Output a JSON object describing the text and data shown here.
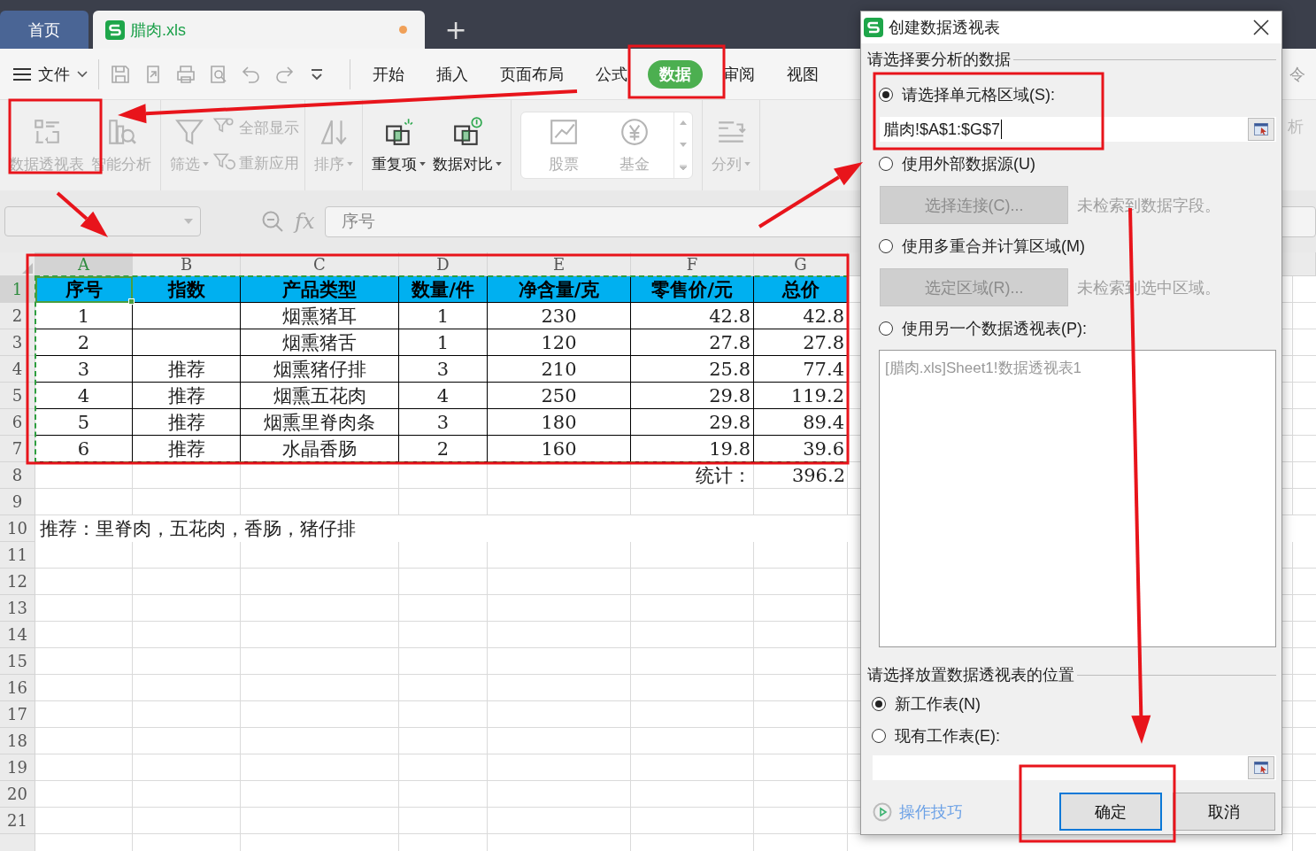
{
  "tabs": [
    {
      "label": "首页",
      "selected": false
    },
    {
      "label": "腊肉.xls",
      "selected": true,
      "modified": true
    }
  ],
  "new_tab": "+",
  "menu": {
    "file": "文件",
    "tabs": [
      {
        "label": "开始",
        "selected": false
      },
      {
        "label": "插入",
        "selected": false
      },
      {
        "label": "页面布局",
        "selected": false
      },
      {
        "label": "公式",
        "selected": false
      },
      {
        "label": "数据",
        "selected": true
      },
      {
        "label": "审阅",
        "selected": false
      },
      {
        "label": "视图",
        "selected": false
      }
    ],
    "overflow_text": "令"
  },
  "ribbon": {
    "groups": [
      {
        "items": [
          {
            "kind": "large",
            "label": "数据透视表",
            "disabled": true,
            "dropdown": false
          },
          {
            "kind": "large",
            "label": "智能分析",
            "disabled": true,
            "dropdown": false
          }
        ]
      },
      {
        "items": [
          {
            "kind": "large",
            "label": "筛选",
            "disabled": true,
            "dropdown": true
          },
          {
            "kind": "stack",
            "items": [
              {
                "label": "全部显示",
                "disabled": true
              },
              {
                "label": "重新应用",
                "disabled": true
              }
            ]
          }
        ]
      },
      {
        "items": [
          {
            "kind": "large",
            "label": "排序",
            "disabled": true,
            "dropdown": true
          }
        ]
      },
      {
        "items": [
          {
            "kind": "large",
            "label": "重复项",
            "disabled": false,
            "dropdown": true
          },
          {
            "kind": "large",
            "label": "数据对比",
            "disabled": false,
            "dropdown": true
          }
        ]
      },
      {
        "items": [
          {
            "kind": "gallery",
            "items": [
              {
                "label": "股票",
                "disabled": true
              },
              {
                "label": "基金",
                "disabled": true
              }
            ]
          }
        ]
      },
      {
        "items": [
          {
            "kind": "large",
            "label": "分列",
            "disabled": true,
            "dropdown": true
          }
        ]
      }
    ],
    "overflow_text": "析"
  },
  "formula_bar": {
    "function_label": "fx",
    "formula": "序号"
  },
  "sheet": {
    "columns": [
      {
        "label": "A",
        "selected": true
      },
      {
        "label": "B",
        "selected": false
      },
      {
        "label": "C",
        "selected": false
      },
      {
        "label": "D",
        "selected": false
      },
      {
        "label": "E",
        "selected": false
      },
      {
        "label": "F",
        "selected": false
      },
      {
        "label": "G",
        "selected": false
      }
    ],
    "rows": [
      {
        "label": "1",
        "selected": true,
        "kind": "header",
        "cells": [
          "序号",
          "指数",
          "产品类型",
          "数量/件",
          "净含量/克",
          "零售价/元",
          "总价"
        ]
      },
      {
        "label": "2",
        "selected": false,
        "kind": "data",
        "cells": [
          "1",
          null,
          "烟熏猪耳",
          "1",
          "230",
          "42.8",
          "42.8"
        ]
      },
      {
        "label": "3",
        "selected": false,
        "kind": "data",
        "cells": [
          "2",
          null,
          "烟熏猪舌",
          "1",
          "120",
          "27.8",
          "27.8"
        ]
      },
      {
        "label": "4",
        "selected": false,
        "kind": "data",
        "cells": [
          "3",
          "推荐",
          "烟熏猪仔排",
          "3",
          "210",
          "25.8",
          "77.4"
        ]
      },
      {
        "label": "5",
        "selected": false,
        "kind": "data",
        "cells": [
          "4",
          "推荐",
          "烟熏五花肉",
          "4",
          "250",
          "29.8",
          "119.2"
        ]
      },
      {
        "label": "6",
        "selected": false,
        "kind": "data",
        "cells": [
          "5",
          "推荐",
          "烟熏里脊肉条",
          "3",
          "180",
          "29.8",
          "89.4"
        ]
      },
      {
        "label": "7",
        "selected": false,
        "kind": "data",
        "cells": [
          "6",
          "推荐",
          "水晶香肠",
          "2",
          "160",
          "19.8",
          "39.6"
        ]
      },
      {
        "label": "8",
        "selected": false,
        "kind": "total",
        "cells": [
          null,
          null,
          null,
          null,
          null,
          "统计：",
          "396.2"
        ]
      },
      {
        "label": "9",
        "selected": false,
        "kind": "empty"
      },
      {
        "label": "10",
        "selected": false,
        "kind": "note",
        "cells": [
          "推荐：里脊肉，五花肉，香肠，猪仔排"
        ]
      },
      {
        "label": "11",
        "selected": false,
        "kind": "empty"
      },
      {
        "label": "12",
        "selected": false,
        "kind": "empty"
      },
      {
        "label": "13",
        "selected": false,
        "kind": "empty"
      },
      {
        "label": "14",
        "selected": false,
        "kind": "empty"
      },
      {
        "label": "15",
        "selected": false,
        "kind": "empty"
      },
      {
        "label": "16",
        "selected": false,
        "kind": "empty"
      },
      {
        "label": "17",
        "selected": false,
        "kind": "empty"
      },
      {
        "label": "18",
        "selected": false,
        "kind": "empty"
      },
      {
        "label": "19",
        "selected": false,
        "kind": "empty"
      },
      {
        "label": "20",
        "selected": false,
        "kind": "empty"
      },
      {
        "label": "21",
        "selected": false,
        "kind": "empty"
      }
    ]
  },
  "dialog": {
    "title": "创建数据透视表",
    "source": {
      "label": "请选择要分析的数据",
      "options": [
        {
          "kind": "range",
          "label": "请选择单元格区域(S):",
          "selected": true,
          "value": "腊肉!$A$1:$G$7"
        },
        {
          "kind": "button",
          "label": "使用外部数据源(U)",
          "selected": false,
          "button": "选择连接(C)...",
          "disabled": true,
          "hint": "未检索到数据字段。"
        },
        {
          "kind": "button",
          "label": "使用多重合并计算区域(M)",
          "selected": false,
          "button": "选定区域(R)...",
          "disabled": true,
          "hint": "未检索到选中区域。"
        },
        {
          "kind": "list",
          "label": "使用另一个数据透视表(P):",
          "selected": false,
          "items": [
            "[腊肉.xls]Sheet1!数据透视表1"
          ]
        }
      ]
    },
    "placement": {
      "label": "请选择放置数据透视表的位置",
      "options": [
        {
          "kind": "plain",
          "label": "新工作表(N)",
          "selected": true
        },
        {
          "kind": "range",
          "label": "现有工作表(E):",
          "selected": false
        }
      ]
    },
    "help_link": "操作技巧",
    "buttons": [
      {
        "label": "确定",
        "kind": "primary"
      },
      {
        "label": "取消",
        "kind": "normal"
      }
    ]
  }
}
